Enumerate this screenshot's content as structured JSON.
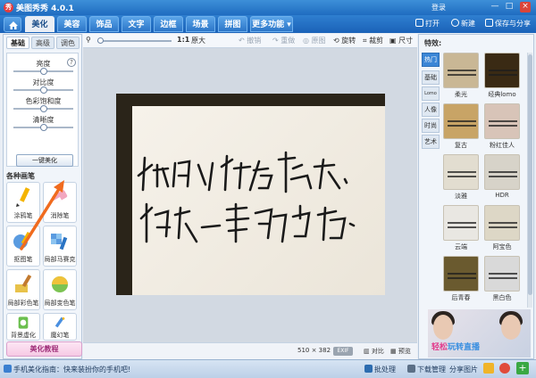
{
  "app": {
    "title": "美图秀秀 4.0.1",
    "login": "登录"
  },
  "menu": {
    "tabs": [
      "美化",
      "美容",
      "饰品",
      "文字",
      "边框",
      "场景",
      "拼图"
    ],
    "active": "美化",
    "more": "更多功能",
    "open": "打开",
    "new": "新建",
    "save_share": "保存与分享"
  },
  "left": {
    "tabs": [
      "基础",
      "高级",
      "调色"
    ],
    "active_tab": "基础",
    "sliders": [
      {
        "label": "亮度"
      },
      {
        "label": "对比度"
      },
      {
        "label": "色彩饱和度"
      },
      {
        "label": "清晰度"
      }
    ],
    "one_key": "一键美化",
    "section": "各种画笔",
    "tools": [
      {
        "label": "涂鸦笔",
        "icon": "pencil-icon",
        "badge": ""
      },
      {
        "label": "消除笔",
        "icon": "eraser-icon",
        "badge": ""
      },
      {
        "label": "抠图笔",
        "icon": "cutout-pen-icon",
        "badge": ""
      },
      {
        "label": "局部马赛克",
        "icon": "mosaic-icon",
        "badge": ""
      },
      {
        "label": "局部彩色笔",
        "icon": "color-brush-icon",
        "badge": ""
      },
      {
        "label": "局部变色笔",
        "icon": "color-change-icon",
        "badge": ""
      },
      {
        "label": "背景虚化",
        "icon": "blur-icon",
        "badge": ""
      },
      {
        "label": "魔幻笔",
        "icon": "magic-pen-icon",
        "badge": ""
      }
    ],
    "tutorial": "美化教程"
  },
  "toolbar": {
    "zoom_value": "1:1",
    "original": "原大",
    "undo": "撤销",
    "redo": "重做",
    "restore": "原图",
    "rotate": "旋转",
    "crop": "裁剪",
    "resize": "尺寸"
  },
  "canvas": {
    "image_size": "510 × 382",
    "exif": "EXIF",
    "compare": "对比",
    "preview": "预览"
  },
  "right": {
    "title": "特效:",
    "vtabs": [
      "热门",
      "基础",
      "Lomo",
      "人像",
      "时尚",
      "艺术"
    ],
    "active_vtab": "热门",
    "effects": [
      {
        "label": "柔光",
        "tone": "#c9b795"
      },
      {
        "label": "经典lomo",
        "tone": "#3a2a14"
      },
      {
        "label": "复古",
        "tone": "#c8a466"
      },
      {
        "label": "粉红佳人",
        "tone": "#d8c4b8"
      },
      {
        "label": "淡雅",
        "tone": "#e2ddd0"
      },
      {
        "label": "HDR",
        "tone": "#d7d3c9"
      },
      {
        "label": "云端",
        "tone": "#e9e7e2"
      },
      {
        "label": "阿宝色",
        "tone": "#ddd7c6"
      },
      {
        "label": "后青春",
        "tone": "#6a5a2f"
      },
      {
        "label": "黑白色",
        "tone": "#d9d9d9"
      }
    ],
    "ad_text_pink": "轻松",
    "ad_text_blue": "玩转直播"
  },
  "status": {
    "tip": "手机美化指南：快来装扮你的手机吧!",
    "batch": "批处理",
    "download": "下载管理",
    "share": "分享图片"
  }
}
